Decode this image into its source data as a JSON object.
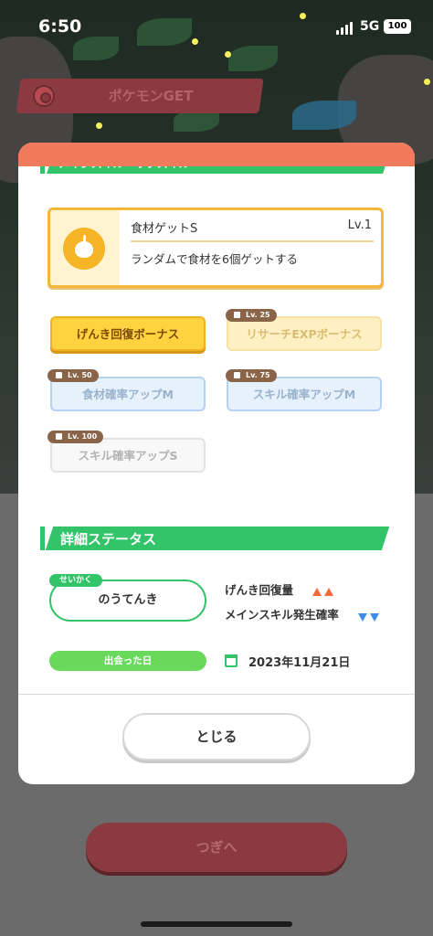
{
  "status_bar": {
    "time": "6:50",
    "network": "5G",
    "battery": "100"
  },
  "banner": {
    "label": "ポケモンGET"
  },
  "modal": {
    "top_section_title": "メインスキル・サブスキル",
    "main_skill": {
      "name": "食材ゲットS",
      "level": "Lv.1",
      "description": "ランダムで食材を6個ゲットする",
      "icon": "apple-icon"
    },
    "sub_skills": [
      {
        "label": "げんき回復ボーナス",
        "unlock_level": "",
        "state": "active"
      },
      {
        "label": "リサーチEXPボーナス",
        "unlock_level": "Lv. 25",
        "state": "locked"
      },
      {
        "label": "食材確率アップM",
        "unlock_level": "Lv. 50",
        "state": "locked"
      },
      {
        "label": "スキル確率アップM",
        "unlock_level": "Lv. 75",
        "state": "locked"
      },
      {
        "label": "スキル確率アップS",
        "unlock_level": "Lv. 100",
        "state": "locked"
      }
    ],
    "details_section_title": "詳細ステータス",
    "nature": {
      "label": "せいかく",
      "value": "のうてんき"
    },
    "stats": [
      {
        "label": "げんき回復量",
        "direction": "up"
      },
      {
        "label": "メインスキル発生確率",
        "direction": "down"
      }
    ],
    "met": {
      "label": "出会った日",
      "date": "2023年11月21日"
    },
    "close_label": "とじる"
  },
  "next_label": "つぎへ",
  "colors": {
    "accent_green": "#33c46a",
    "header_orange": "#f07a5c",
    "skill_gold": "#f4b73a",
    "up_arrow": "#f26a3b",
    "down_arrow": "#3d8de6"
  }
}
